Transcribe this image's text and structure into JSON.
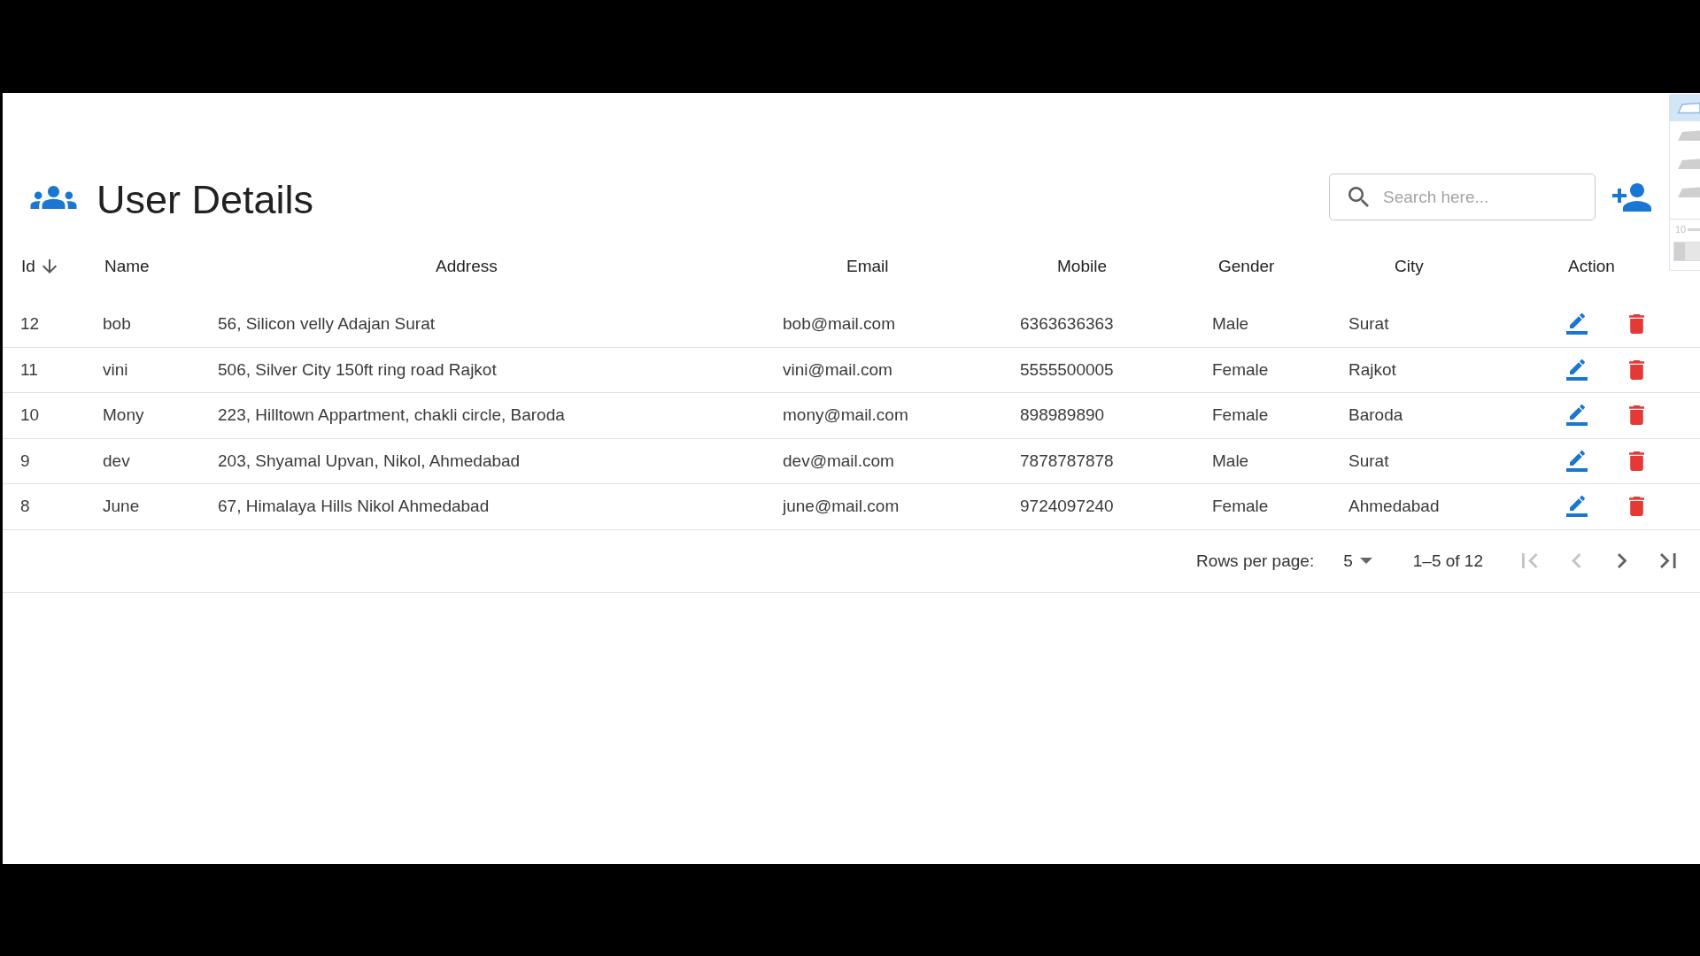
{
  "header": {
    "title": "User Details",
    "search": {
      "placeholder": "Search here..."
    }
  },
  "table": {
    "columns": [
      {
        "label": "Id",
        "sorted": true
      },
      {
        "label": "Name",
        "sorted": false
      },
      {
        "label": "Address",
        "sorted": false
      },
      {
        "label": "Email",
        "sorted": false
      },
      {
        "label": "Mobile",
        "sorted": false
      },
      {
        "label": "Gender",
        "sorted": false
      },
      {
        "label": "City",
        "sorted": false
      },
      {
        "label": "Action",
        "sorted": false
      }
    ],
    "rows": [
      {
        "cells": [
          "12",
          "bob",
          "56, Silicon velly Adajan Surat",
          "bob@mail.com",
          "6363636363",
          "Male",
          "Surat"
        ]
      },
      {
        "cells": [
          "11",
          "vini",
          "506, Silver City 150ft ring road Rajkot",
          "vini@mail.com",
          "5555500005",
          "Female",
          "Rajkot"
        ]
      },
      {
        "cells": [
          "10",
          "Mony",
          "223, Hilltown Appartment, chakli circle, Baroda",
          "mony@mail.com",
          "898989890",
          "Female",
          "Baroda"
        ]
      },
      {
        "cells": [
          "9",
          "dev",
          "203, Shyamal Upvan, Nikol, Ahmedabad",
          "dev@mail.com",
          "7878787878",
          "Male",
          "Surat"
        ]
      },
      {
        "cells": [
          "8",
          "June",
          "67, Himalaya Hills Nikol Ahmedabad",
          "june@mail.com",
          "9724097240",
          "Female",
          "Ahmedabad"
        ]
      }
    ]
  },
  "pagination": {
    "rows_per_page_label": "Rows per page:",
    "rows_per_page": "5",
    "range": "1–5 of 12",
    "buttons": [
      {
        "kind": "first",
        "disabled": true
      },
      {
        "kind": "previous",
        "disabled": true
      },
      {
        "kind": "next",
        "disabled": false
      },
      {
        "kind": "last",
        "disabled": false
      }
    ]
  },
  "side_toolbar": {
    "tools": [
      {
        "selected": true
      },
      {
        "selected": false
      },
      {
        "selected": false
      },
      {
        "selected": false
      }
    ],
    "size_label": "10"
  }
}
